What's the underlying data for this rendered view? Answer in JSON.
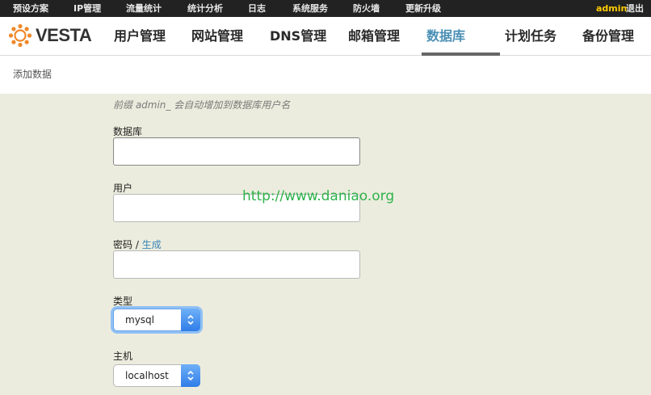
{
  "topbar": {
    "items": [
      "预设方案",
      "IP管理",
      "流量统计",
      "统计分析",
      "日志",
      "系统服务",
      "防火墙",
      "更新升级"
    ],
    "user": "admin",
    "logout": "退出"
  },
  "brand": {
    "name": "VESTA"
  },
  "nav": {
    "items": [
      "用户管理",
      "网站管理",
      "DNS管理",
      "邮箱管理",
      "数据库",
      "计划任务",
      "备份管理"
    ],
    "active": "数据库"
  },
  "page": {
    "title": "添加数据"
  },
  "form": {
    "hint": "前缀 admin_ 会自动增加到数据库用户名",
    "database_label": "数据库",
    "database_value": "",
    "user_label": "用户",
    "user_value": "",
    "password_label": "密码 /",
    "generate_link": "生成",
    "password_value": "",
    "type_label": "类型",
    "type_value": "mysql",
    "host_label": "主机",
    "host_value": "localhost"
  },
  "watermark": "http://www.daniao.org",
  "colors": {
    "topbar_bg": "#222222",
    "user_name": "#ffcc00",
    "active_nav": "#4a8fb5",
    "page_bg": "#ececde",
    "link": "#3a86b7",
    "select_button": "#3d87ea",
    "watermark": "#2fb24a"
  }
}
